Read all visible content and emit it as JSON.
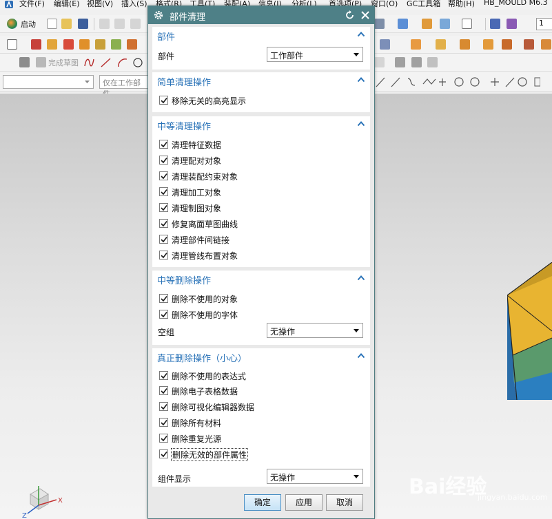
{
  "app": {
    "menu": [
      "文件(F)",
      "编辑(E)",
      "视图(V)",
      "插入(S)",
      "格式(R)",
      "工具(T)",
      "装配(A)",
      "信息(I)",
      "分析(L)",
      "首选项(P)",
      "窗口(O)",
      "GC工具箱",
      "帮助(H)",
      "HB_MOULD M6.3"
    ],
    "toolbar": {
      "start_label": "启动",
      "finish_sketch_label": "完成草图",
      "filter_placeholder": "仅在工作部件",
      "layer_value": "1"
    }
  },
  "dialog": {
    "title": "部件清理",
    "groups": {
      "part": {
        "title": "部件",
        "field_label": "部件",
        "field_value": "工作部件"
      },
      "simple": {
        "title": "简单清理操作",
        "items": [
          {
            "label": "移除无关的高亮显示",
            "checked": true
          }
        ]
      },
      "medium_cleanup": {
        "title": "中等清理操作",
        "items": [
          {
            "label": "清理特征数据",
            "checked": true
          },
          {
            "label": "清理配对对象",
            "checked": true
          },
          {
            "label": "清理装配约束对象",
            "checked": true
          },
          {
            "label": "清理加工对象",
            "checked": true
          },
          {
            "label": "清理制图对象",
            "checked": true
          },
          {
            "label": "修复离面草图曲线",
            "checked": true
          },
          {
            "label": "清理部件间链接",
            "checked": true
          },
          {
            "label": "清理管线布置对象",
            "checked": true
          }
        ]
      },
      "medium_delete": {
        "title": "中等删除操作",
        "items": [
          {
            "label": "删除不使用的对象",
            "checked": true
          },
          {
            "label": "删除不使用的字体",
            "checked": true
          }
        ],
        "field_label": "空组",
        "field_value": "无操作"
      },
      "true_delete": {
        "title": "真正删除操作（小心）",
        "items": [
          {
            "label": "删除不使用的表达式",
            "checked": true
          },
          {
            "label": "删除电子表格数据",
            "checked": true
          },
          {
            "label": "删除可视化编辑器数据",
            "checked": true
          },
          {
            "label": "删除所有材料",
            "checked": true
          },
          {
            "label": "删除重复光源",
            "checked": true
          },
          {
            "label": "删除无效的部件属性",
            "checked": true
          }
        ],
        "field_label": "组件显示",
        "field_value": "无操作"
      }
    },
    "buttons": {
      "ok": "确定",
      "apply": "应用",
      "cancel": "取消"
    }
  },
  "watermark": {
    "main": "Bai经验",
    "sub": "jingyan.baidu.com"
  },
  "colors": {
    "titlebar": "#4e8087",
    "group_title": "#2a73b8",
    "cube_top": "#e8b431",
    "cube_mid": "#5a9a6c",
    "cube_bottom": "#2b7fc0"
  }
}
